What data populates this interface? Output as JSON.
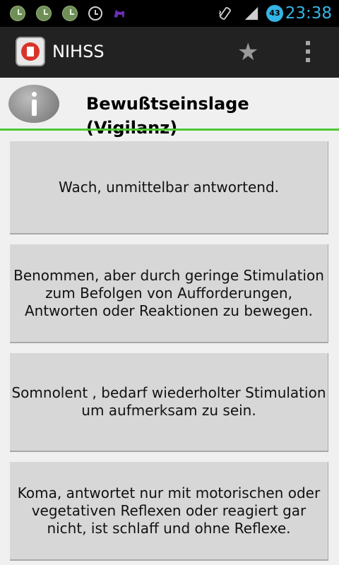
{
  "status_bar": {
    "time": "23:38",
    "battery_level": "43",
    "icons": [
      "clock-icon",
      "clock-icon",
      "clock-icon",
      "alarm-icon",
      "llama-icon",
      "vibrate-icon",
      "signal-icon",
      "battery-icon"
    ],
    "time_color": "#33b5e5"
  },
  "app": {
    "title": "NIHSS",
    "accent_color": "#4cc934"
  },
  "header": {
    "title": "Bewußtseinslage (Vigilanz)"
  },
  "options": [
    "Wach, unmittelbar antwortend.",
    "Benommen, aber durch geringe Stimulation zum Befolgen von Aufforderungen, Antworten oder Reaktionen zu bewegen.",
    "Somnolent , bedarf wiederholter Stimulation um aufmerksam zu sein.",
    "Koma, antwortet nur mit motorischen oder vegetativen Reflexen oder reagiert gar nicht, ist schlaff und ohne Reflexe."
  ]
}
